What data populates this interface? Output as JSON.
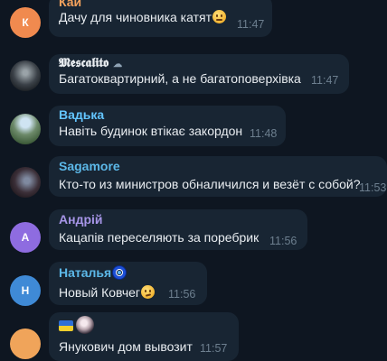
{
  "messages": [
    {
      "author": "Кай",
      "text": "Дачу для чиновника катят",
      "time": "11:47",
      "avatar_letter": "К",
      "name_color": "#f5a25d",
      "avatar_color": "#f08a4f"
    },
    {
      "author": "𝕸𝖊𝖘𝖈𝖆𝖑𝖎𝖙𝖔",
      "author_suffix": "☁",
      "text": "Багатоквартирний, а не багатоповерхівка",
      "time": "11:47",
      "name_color": "#e9edf1"
    },
    {
      "author": "Вадька",
      "text": "Навіть будинок втікає закордон",
      "time": "11:48",
      "name_color": "#63c5ff"
    },
    {
      "author": "Sagamore",
      "text": "Кто-то из министров обналичился и везёт с собой?",
      "time": "11:53",
      "name_color": "#5cb8e8"
    },
    {
      "author": "Андрій",
      "text": "Кацапів переселяють за поребрик",
      "time": "11:56",
      "avatar_letter": "А",
      "name_color": "#a695e7",
      "avatar_color": "#8e6ce0"
    },
    {
      "author": "Наталья",
      "text": "Новый Ковчег",
      "time": "11:56",
      "avatar_letter": "Н",
      "name_color": "#5cb8e8",
      "avatar_color": "#3f8ad6"
    },
    {
      "author": "",
      "text": "Янукович дом вывозит",
      "time": "11:57",
      "avatar_color": "#f0a45a"
    }
  ],
  "icons": [
    "thinking-emoji",
    "cloud-icon",
    "evil-eye-emoji",
    "smirk-emoji",
    "ukraine-flag-icon"
  ],
  "colors": {
    "background": "#0e1621",
    "bubble": "#182533",
    "text": "#e9edf1",
    "time": "#6d7f8f"
  }
}
